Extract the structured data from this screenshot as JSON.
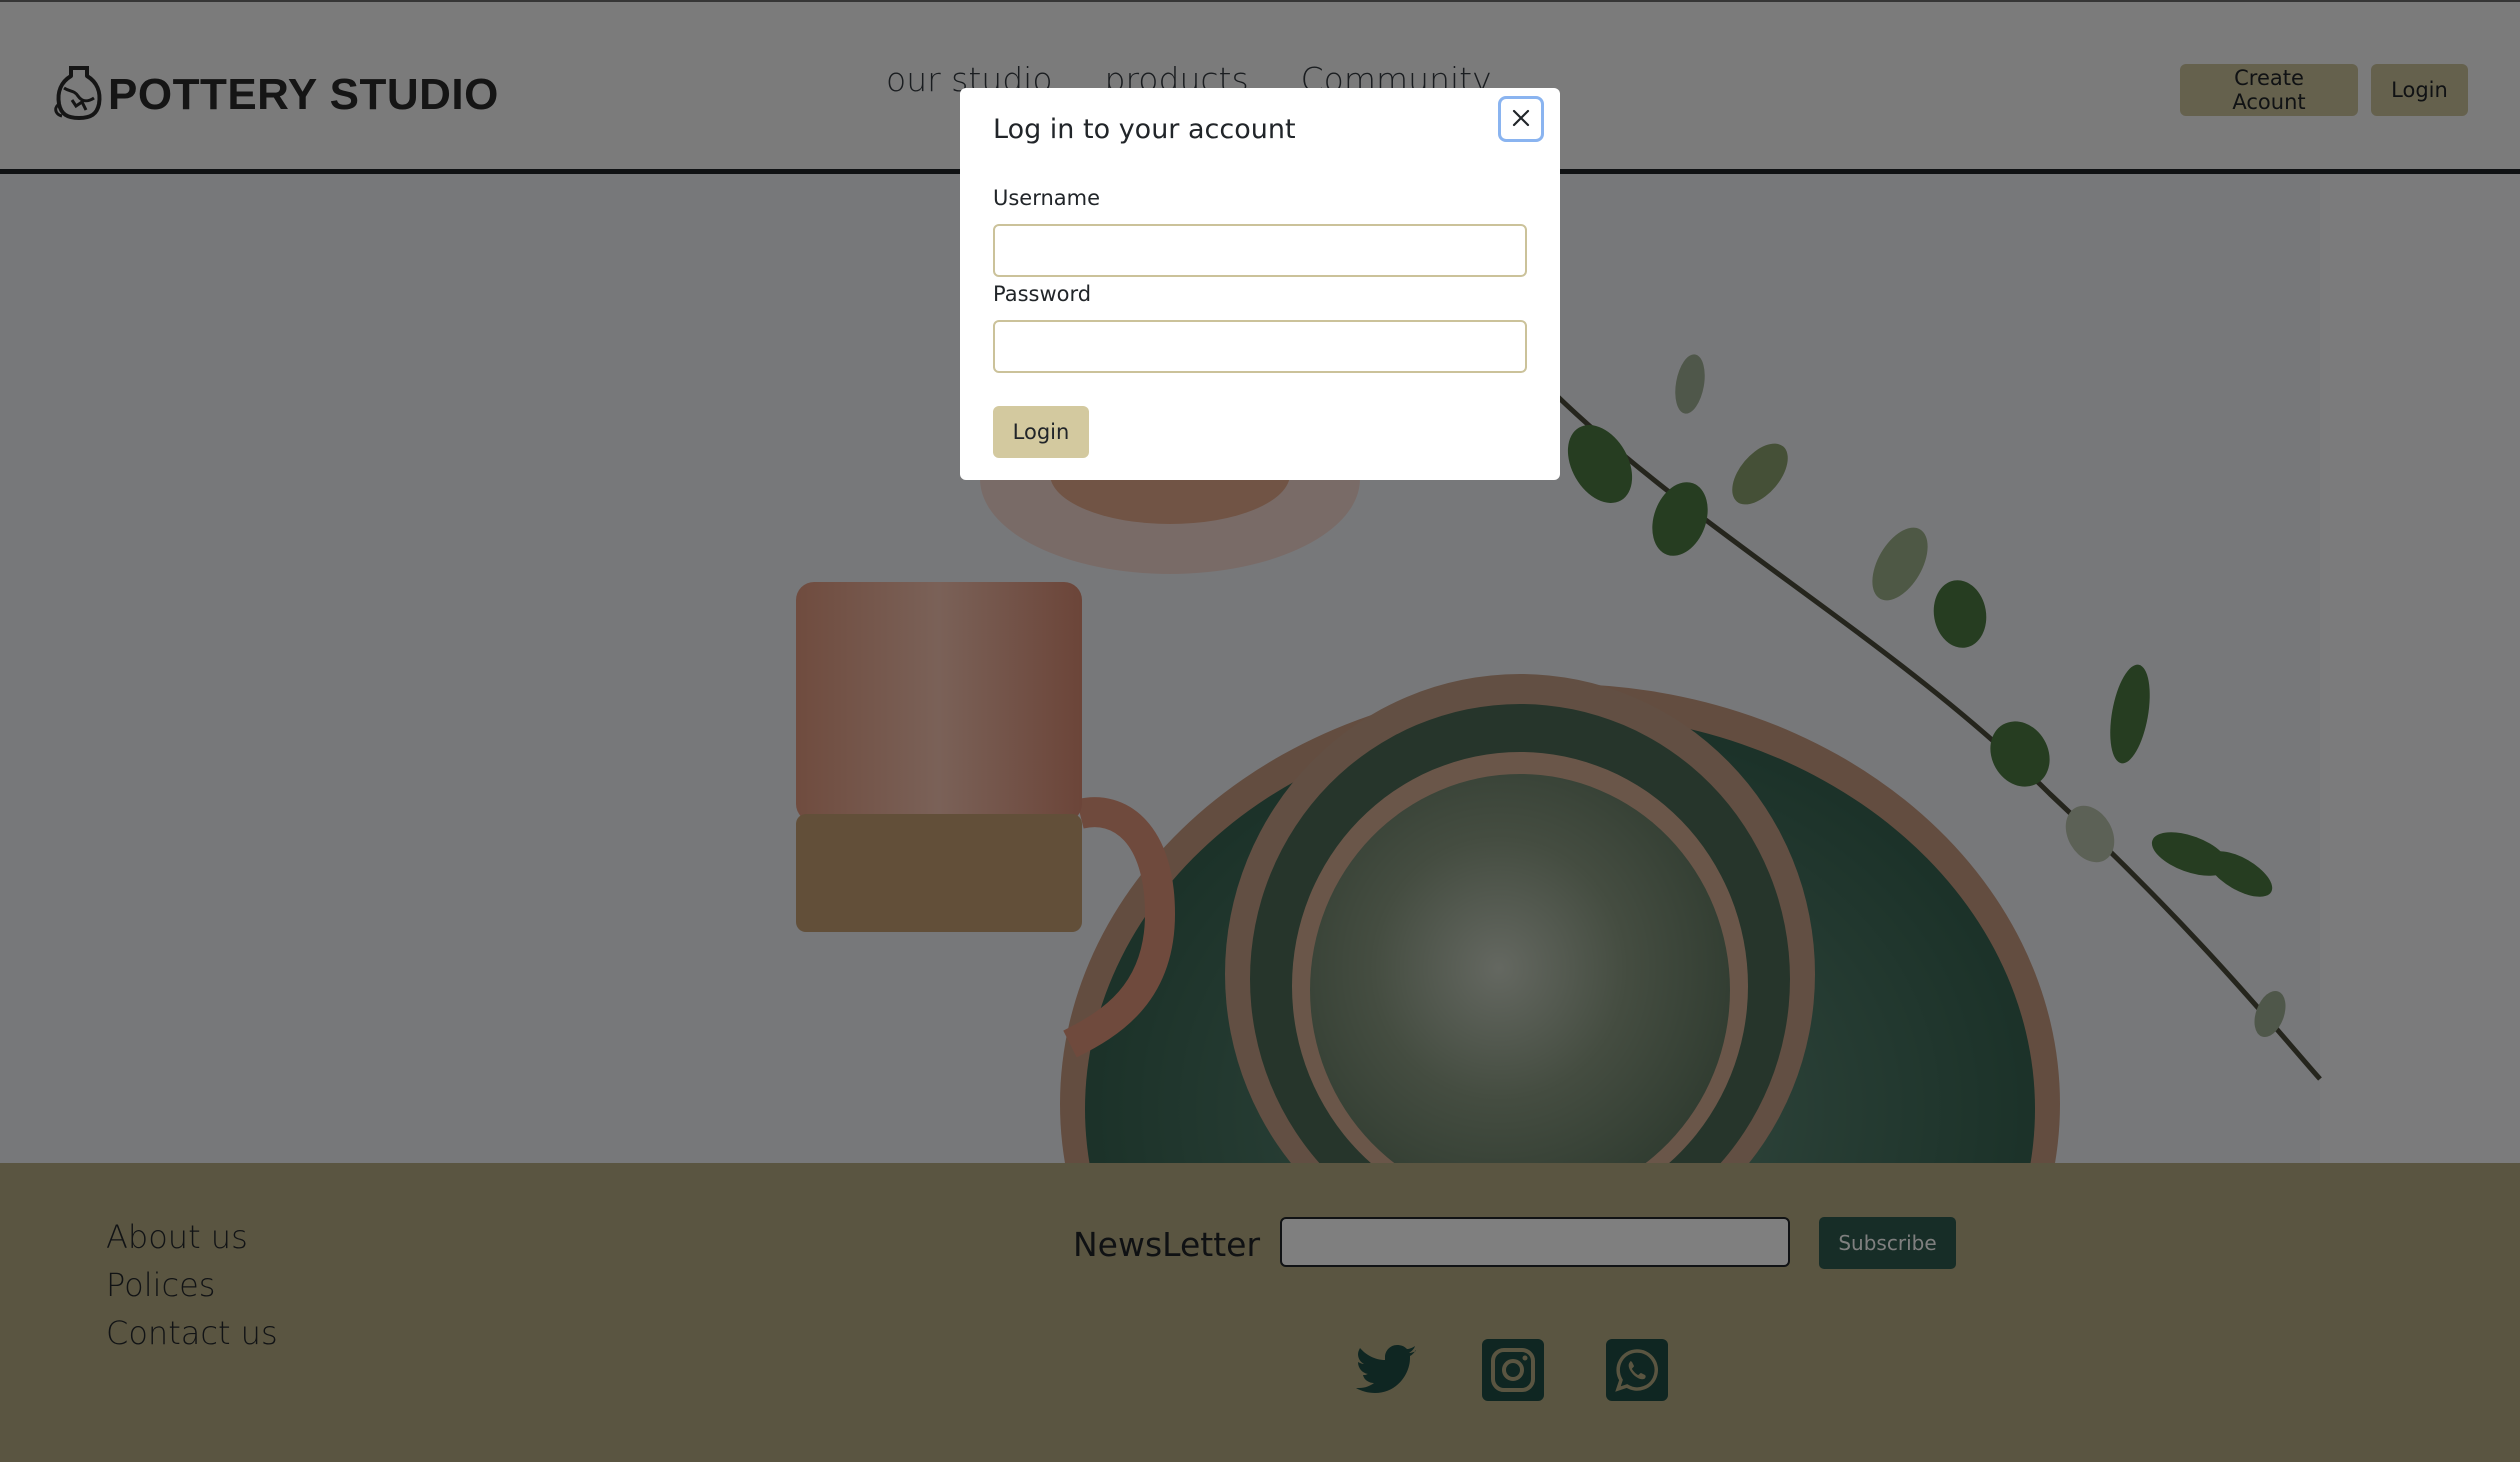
{
  "header": {
    "brand": "POTTERY STUDIO",
    "brand_icon": "vase-icon",
    "nav": [
      "our studio",
      "products",
      "Community"
    ],
    "create_account_label": "Create Acount",
    "login_label": "Login"
  },
  "hero": {
    "image": "pottery-mug-bowls-plate-branch"
  },
  "footer": {
    "links": [
      "About us",
      "Polices",
      "Contact us"
    ],
    "newsletter_label": "NewsLetter",
    "newsletter_placeholder": "",
    "subscribe_label": "Subscribe",
    "social_icons": [
      "twitter-icon",
      "instagram-icon",
      "whatsapp-icon"
    ]
  },
  "modal": {
    "title": "Log in to your account",
    "username_label": "Username",
    "username_value": "",
    "password_label": "Password",
    "password_value": "",
    "login_label": "Login",
    "close_icon": "close-icon"
  },
  "colors": {
    "accent": "#cbc29a",
    "footer_bg": "#b5ab83",
    "subscribe_bg": "#2f5a4e",
    "overlay": "rgba(0,0,0,0.5)"
  }
}
